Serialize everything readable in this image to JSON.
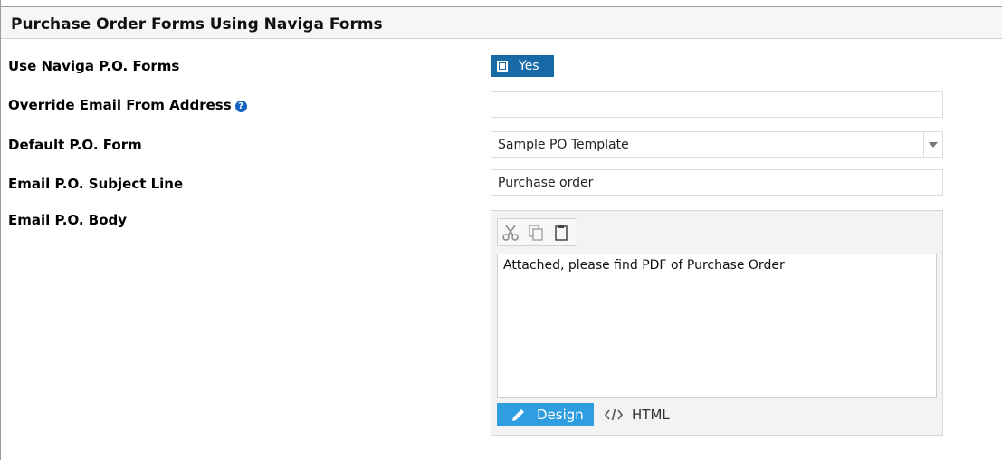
{
  "section": {
    "title": "Purchase Order Forms Using Naviga Forms"
  },
  "fields": {
    "use_forms": {
      "label": "Use Naviga P.O. Forms",
      "toggle_label": "Yes"
    },
    "override_email": {
      "label": "Override Email From Address",
      "help_glyph": "?",
      "value": ""
    },
    "default_form": {
      "label": "Default P.O. Form",
      "value": "Sample PO Template"
    },
    "subject": {
      "label": "Email P.O. Subject Line",
      "value": "Purchase order"
    },
    "body": {
      "label": "Email P.O. Body",
      "content": "Attached, please find PDF of Purchase Order",
      "design_label": "Design",
      "html_label": "HTML"
    }
  },
  "colors": {
    "toggle_bg": "#176aa6",
    "design_tab_bg": "#2f9ee0",
    "help_icon": "#1565c0"
  },
  "icons": {
    "toolbar": [
      "cut-icon",
      "copy-icon",
      "paste-icon"
    ],
    "design": "pencil-icon",
    "html": "code-icon",
    "help": "question-circle-icon"
  }
}
